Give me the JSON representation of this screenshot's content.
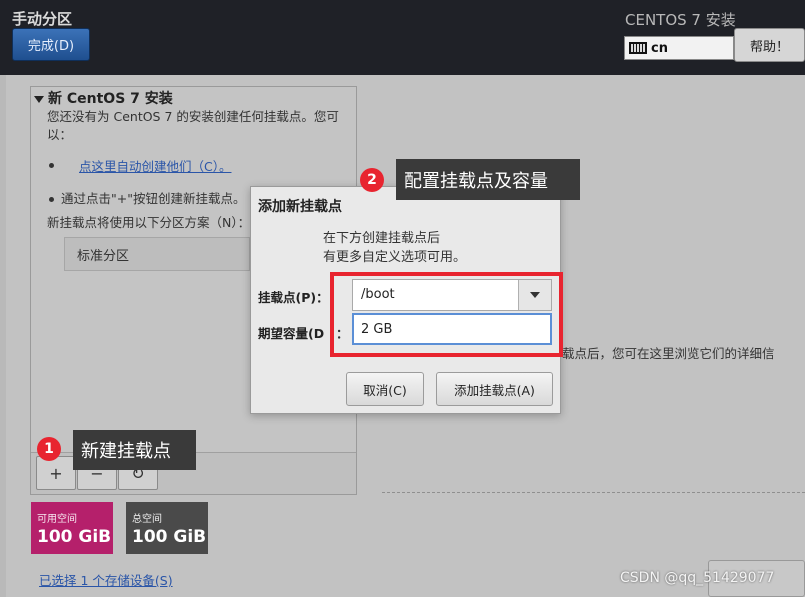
{
  "header": {
    "title": "手动分区",
    "done_label": "完成(D)",
    "product": "CENTOS 7 安装",
    "keyboard": "cn",
    "help_label": "帮助！"
  },
  "left": {
    "section_title": "新 CentOS 7 安装",
    "no_mount_line1": "您还没有为 CentOS 7 的安装创建任何挂载点。您可",
    "no_mount_line2": "以：",
    "auto_link": "点这里自动创建他们（C）。",
    "manual_text": "通过点击\"+\"按钮创建新挂载点。",
    "scheme_text": "新挂载点将使用以下分区方案（N）：",
    "scheme_value": "标准分区",
    "add_symbol": "+",
    "remove_symbol": "−",
    "refresh_symbol": "↻"
  },
  "cards": {
    "available_label": "可用空间",
    "available_value": "100 GiB",
    "total_label": "总空间",
    "total_value": "100 GiB",
    "available_color": "#b5206b",
    "total_color": "#4a4a4a"
  },
  "storage_link": "已选择 1 个存储设备(S)",
  "right_text": "载点后，您可在这里浏览它们的详细信",
  "dialog": {
    "title": "添加新挂载点",
    "desc_line1": "在下方创建挂载点后",
    "desc_line2": "有更多自定义选项可用。",
    "mount_label": "挂载点(P)：",
    "mount_value": "/boot",
    "capacity_label": "期望容量(D",
    "capacity_colon": "：",
    "capacity_value": "2 GB",
    "cancel_label": "取消(C)",
    "add_label": "添加挂载点(A)"
  },
  "annotations": {
    "badge1": "1",
    "callout1": "新建挂载点",
    "badge2": "2",
    "callout2": "配置挂载点及容量",
    "accent": "#e8242f"
  },
  "watermark": "CSDN @qq_51429077"
}
